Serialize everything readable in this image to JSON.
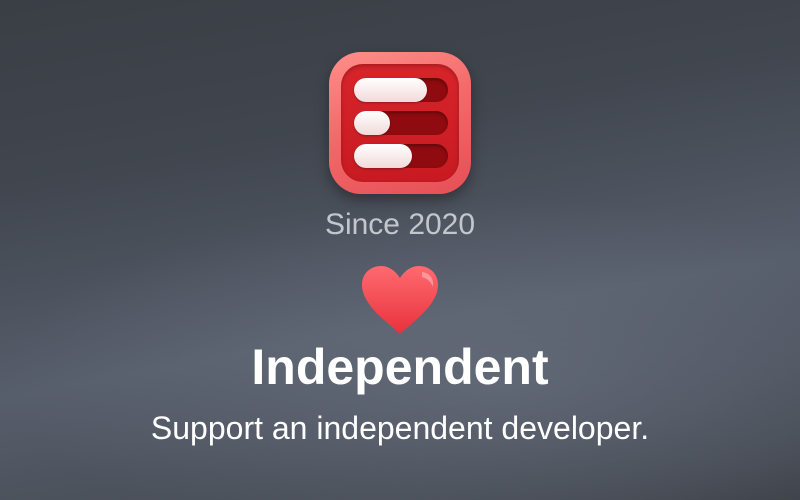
{
  "promo": {
    "since_text": "Since 2020",
    "title": "Independent",
    "subtitle": "Support an independent developer."
  },
  "app_icon": {
    "icon": "sliders-icon",
    "slider_levels": [
      0.78,
      0.38,
      0.62
    ],
    "colors": {
      "frame": "#f26a6a",
      "face": "#d8242b",
      "track": "#8f0b10",
      "knob": "#f5e4e4"
    }
  },
  "heart": {
    "icon": "heart-icon",
    "color": "#f0414a"
  },
  "colors": {
    "text_primary": "#ffffff",
    "text_secondary": "#c3c6cc",
    "background": "#474c55"
  }
}
